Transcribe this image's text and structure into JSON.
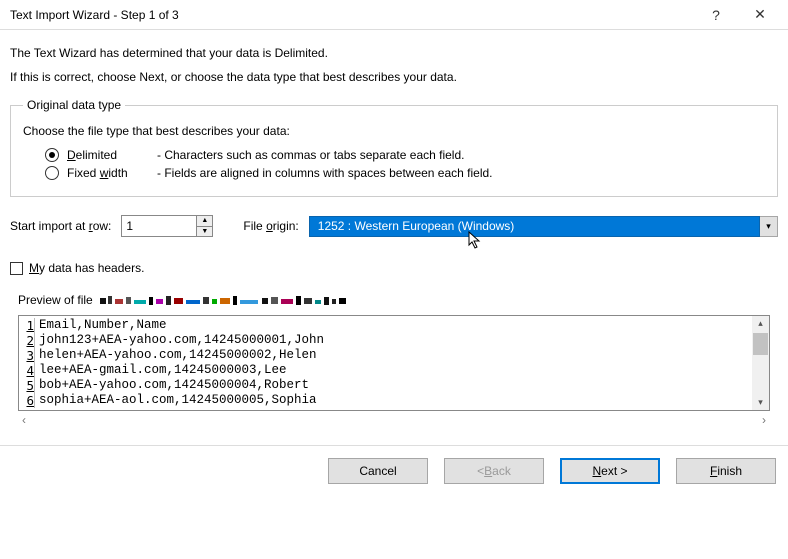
{
  "titlebar": {
    "title": "Text Import Wizard - Step 1 of 3",
    "help_glyph": "?",
    "close_glyph": "✕"
  },
  "intro": {
    "line1": "The Text Wizard has determined that your data is Delimited.",
    "line2": "If this is correct, choose Next, or choose the data type that best describes your data."
  },
  "orig": {
    "legend": "Original data type",
    "choose": "Choose the file type that best describes your data:",
    "delim_pre": "D",
    "delim_post": "elimited",
    "delim_desc": "- Characters such as commas or tabs separate each field.",
    "fixed_pre": "Fixed ",
    "fixed_mid": "w",
    "fixed_post": "idth",
    "fixed_desc": "- Fields are aligned in columns with spaces between each field."
  },
  "rowctrl": {
    "start_label": "Start import at ",
    "start_u": "r",
    "start_post": "ow:",
    "start_value": "1",
    "origin_label_pre": "File ",
    "origin_label_u": "o",
    "origin_label_post": "rigin:",
    "origin_value": "1252 : Western European (Windows)"
  },
  "headers": {
    "pre": "",
    "u": "M",
    "post": "y data has headers."
  },
  "preview": {
    "label": "Preview of file ",
    "lines": [
      "Email,Number,Name",
      "john123+AEA-yahoo.com,14245000001,John",
      "helen+AEA-yahoo.com,14245000002,Helen",
      "lee+AEA-gmail.com,14245000003,Lee",
      "bob+AEA-yahoo.com,14245000004,Robert",
      "sophia+AEA-aol.com,14245000005,Sophia"
    ]
  },
  "footer": {
    "cancel": "Cancel",
    "back_pre": "< ",
    "back_u": "B",
    "back_post": "ack",
    "next_u": "N",
    "next_post": "ext >",
    "finish_u": "F",
    "finish_post": "inish"
  }
}
